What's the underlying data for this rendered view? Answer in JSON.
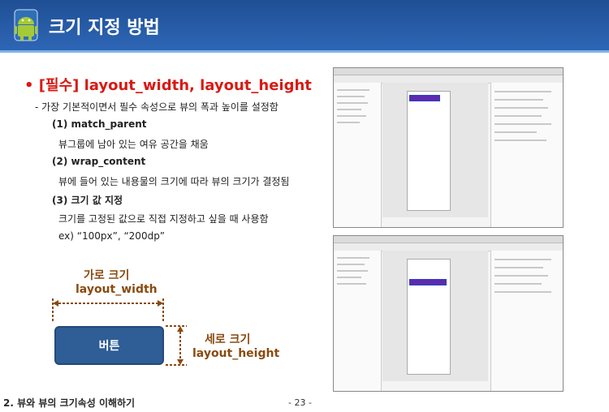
{
  "header": {
    "title": "크기 지정 방법"
  },
  "heading": "[필수] layout_width, layout_height",
  "lines": [
    "- 가장 기본적이면서 필수 속성으로 뷰의 폭과 높이를 설정함",
    "(1) match_parent",
    "뷰그룹에 남아 있는 여유 공간을 채움",
    "(2) wrap_content",
    "뷰에 들어 있는 내용물의 크기에 따라 뷰의 크기가 결정됨",
    "(3) 크기 값 지정",
    "크기를 고정된 값으로 직접 지정하고 싶을 때 사용함",
    "ex) “100px”, “200dp”"
  ],
  "diagram": {
    "width_label": "가로 크기",
    "width_attr": "layout_width",
    "button_label": "버튼",
    "height_label": "세로 크기",
    "height_attr": "layout_height"
  },
  "footer": {
    "left": "2. 뷰와 뷰의 크기속성 이해하기",
    "page": "- 23 -"
  }
}
